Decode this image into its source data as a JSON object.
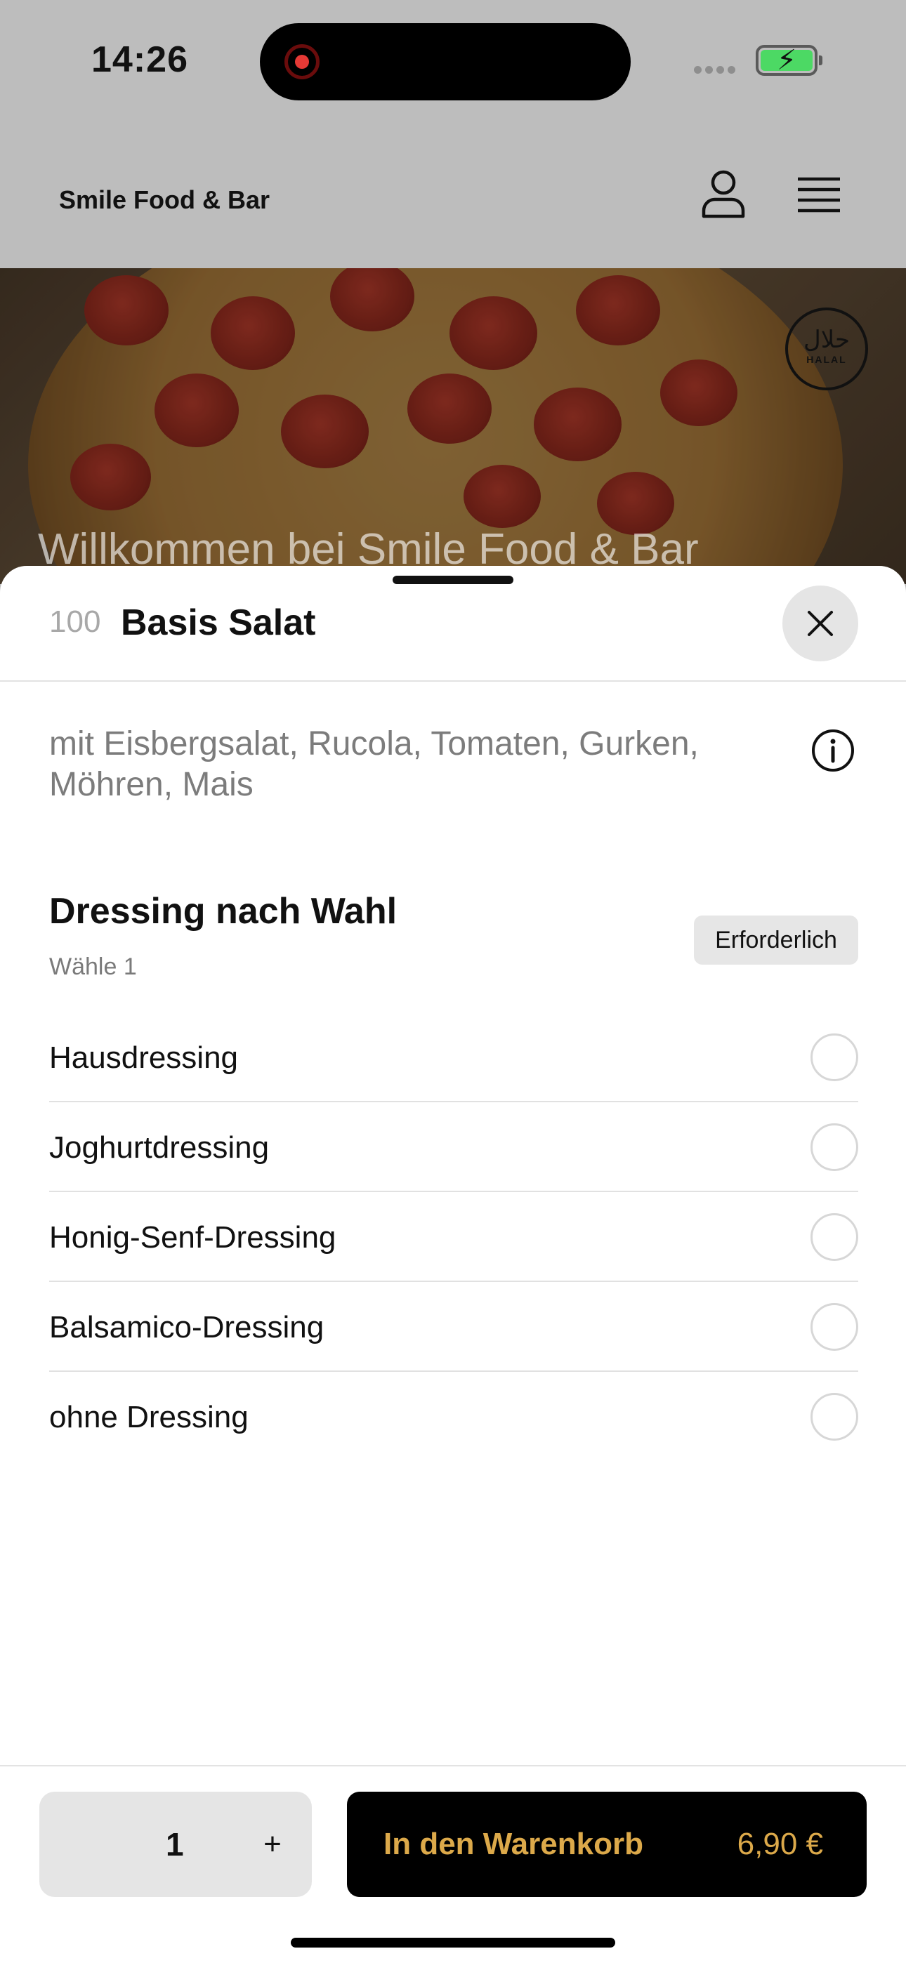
{
  "status_bar": {
    "time": "14:26"
  },
  "header": {
    "brand": "Smile Food & Bar"
  },
  "hero": {
    "title": "Willkommen bei Smile Food & Bar",
    "badge_arabic": "حلال",
    "badge_latin": "HALAL"
  },
  "sheet": {
    "item_number": "100",
    "item_title": "Basis Salat",
    "description": "mit Eisbergsalat, Rucola, Tomaten, Gurken, Möhren, Mais",
    "group": {
      "title": "Dressing nach Wahl",
      "subtitle": "Wähle 1",
      "badge": "Erforderlich",
      "options": [
        {
          "label": "Hausdressing"
        },
        {
          "label": "Joghurtdressing"
        },
        {
          "label": "Honig-Senf-Dressing"
        },
        {
          "label": "Balsamico-Dressing"
        },
        {
          "label": "ohne Dressing"
        }
      ]
    }
  },
  "footer": {
    "quantity": "1",
    "plus_label": "+",
    "cart_label": "In den Warenkorb",
    "price": "6,90 €"
  },
  "colors": {
    "accent": "#dca94a",
    "battery": "#4cd964",
    "record": "#e53935"
  }
}
